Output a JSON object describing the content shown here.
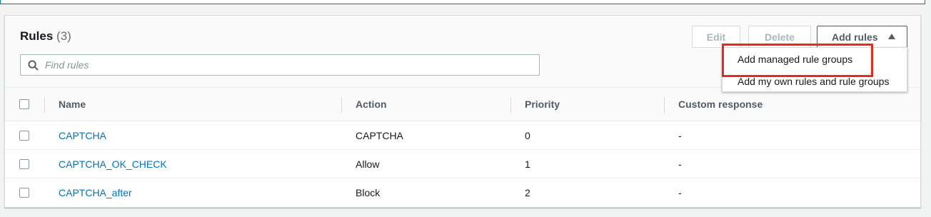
{
  "panel": {
    "title": "Rules",
    "count": "(3)"
  },
  "search": {
    "placeholder": "Find rules"
  },
  "toolbar": {
    "edit_label": "Edit",
    "delete_label": "Delete",
    "add_rules_label": "Add rules"
  },
  "dropdown": {
    "items": [
      {
        "label": "Add managed rule groups"
      },
      {
        "label": "Add my own rules and rule groups"
      }
    ]
  },
  "table": {
    "columns": [
      "Name",
      "Action",
      "Priority",
      "Custom response"
    ],
    "rows": [
      {
        "name": "CAPTCHA",
        "action": "CAPTCHA",
        "priority": "0",
        "custom": "-"
      },
      {
        "name": "CAPTCHA_OK_CHECK",
        "action": "Allow",
        "priority": "1",
        "custom": "-"
      },
      {
        "name": "CAPTCHA_after",
        "action": "Block",
        "priority": "2",
        "custom": "-"
      }
    ]
  },
  "colors": {
    "link": "#0073bb",
    "highlight": "#e8291c",
    "primary_border": "#545b64"
  }
}
